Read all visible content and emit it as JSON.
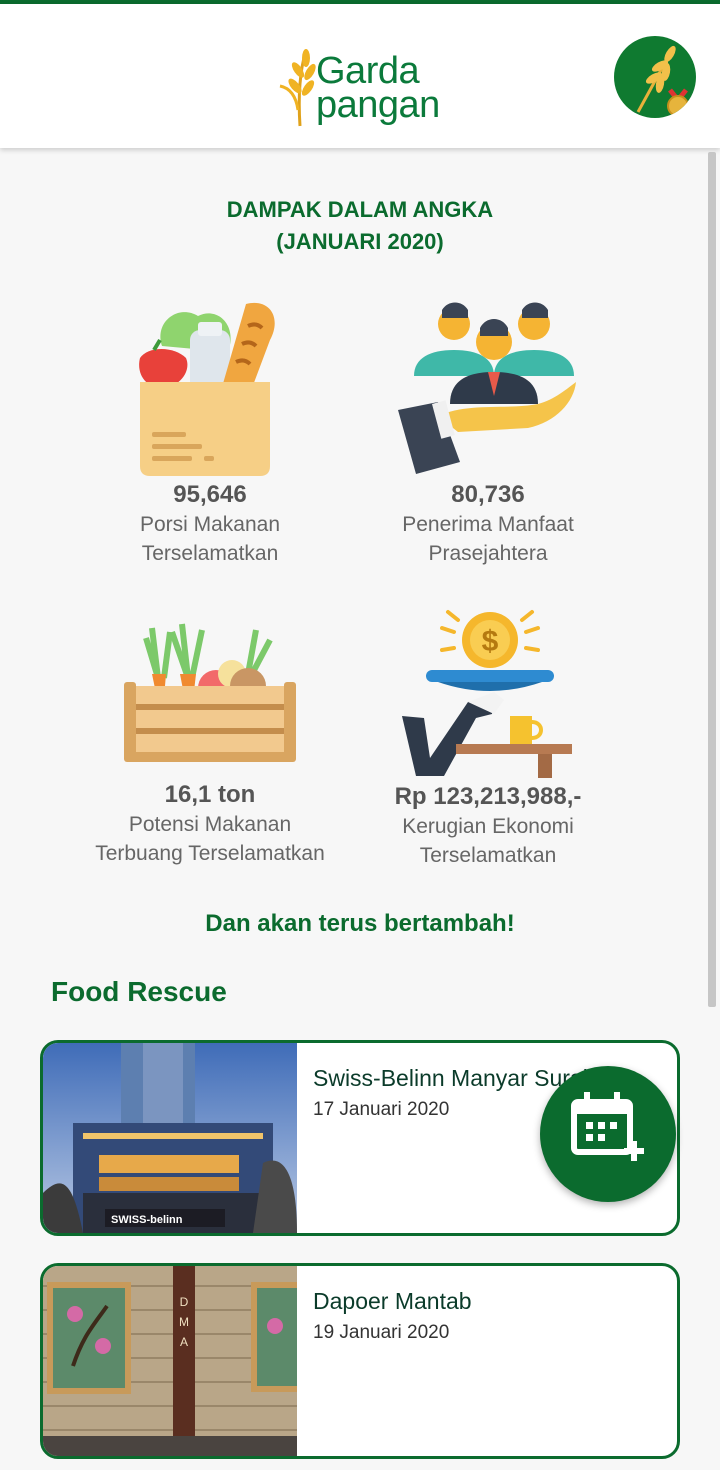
{
  "app": {
    "brand_line1": "Garda",
    "brand_line2": "pangan",
    "avatar_icon": "wheat-medal-icon"
  },
  "stats": {
    "title_line1": "DAMPAK DALAM ANGKA",
    "title_line2": "(JANUARI 2020)",
    "items": [
      {
        "icon": "grocery-bag-icon",
        "value": "95,646",
        "label_line1": "Porsi Makanan",
        "label_line2": "Terselamatkan"
      },
      {
        "icon": "people-on-hand-icon",
        "value": "80,736",
        "label_line1": "Penerima Manfaat",
        "label_line2": "Prasejahtera"
      },
      {
        "icon": "vegetable-crate-icon",
        "value": "16,1 ton",
        "label_line1": "Potensi Makanan",
        "label_line2": "Terbuang Terselamatkan"
      },
      {
        "icon": "coin-on-tray-icon",
        "value": "Rp 123,213,988,-",
        "label_line1": "Kerugian Ekonomi",
        "label_line2": "Terselamatkan"
      }
    ],
    "tagline": "Dan akan terus bertambah!"
  },
  "food_rescue": {
    "section_title": "Food Rescue",
    "cards": [
      {
        "title": "Swiss-Belinn Manyar Surabaya",
        "date": "17 Januari 2020",
        "image": "hotel-building-photo"
      },
      {
        "title": "Dapoer Mantab",
        "date": "19 Januari 2020",
        "image": "restaurant-entrance-photo"
      }
    ]
  },
  "fab": {
    "icon": "calendar-add-icon"
  },
  "colors": {
    "brand_green": "#0b6b2e",
    "background": "#f7f7f7"
  }
}
